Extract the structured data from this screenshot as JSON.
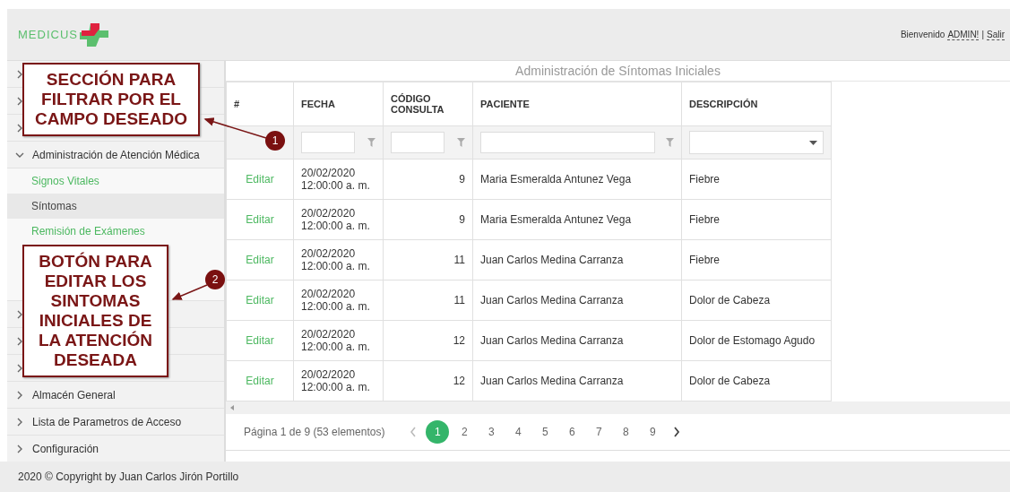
{
  "header": {
    "logo": "MEDICUS",
    "greeting": "Bienvenido",
    "user": "ADMIN!",
    "separator": "|",
    "logout": "Salir"
  },
  "sidebar": {
    "items": [
      {
        "expanded": false
      },
      {
        "expanded": false
      },
      {
        "expanded": false
      },
      {
        "label": "Administración de Atención Médica",
        "expanded": true,
        "children": [
          {
            "label": "Signos Vitales",
            "selected": false
          },
          {
            "label": "Síntomas",
            "selected": true
          },
          {
            "label": "Remisión de Exámenes",
            "selected": false
          }
        ]
      },
      {
        "expanded": false
      },
      {
        "expanded": false
      },
      {
        "expanded": false
      },
      {
        "label": "Almacén General",
        "expanded": false
      },
      {
        "label": "Lista de Parametros de Acceso",
        "expanded": false
      },
      {
        "label": "Configuración",
        "expanded": false
      }
    ]
  },
  "panel": {
    "title": "Administración de Síntomas Iniciales"
  },
  "table": {
    "columns": [
      "#",
      "FECHA",
      "CÓDIGO CONSULTA",
      "PACIENTE",
      "DESCRIPCIÓN"
    ],
    "filters": [
      {
        "kind": "none"
      },
      {
        "kind": "text"
      },
      {
        "kind": "text"
      },
      {
        "kind": "text"
      },
      {
        "kind": "select"
      }
    ],
    "rows": [
      {
        "action": "Editar",
        "date": "20/02/2020",
        "time": "12:00:00 a. m.",
        "code": "9",
        "patient": "Maria Esmeralda Antunez Vega",
        "description": "Fiebre"
      },
      {
        "action": "Editar",
        "date": "20/02/2020",
        "time": "12:00:00 a. m.",
        "code": "9",
        "patient": "Maria Esmeralda Antunez Vega",
        "description": "Fiebre"
      },
      {
        "action": "Editar",
        "date": "20/02/2020",
        "time": "12:00:00 a. m.",
        "code": "11",
        "patient": "Juan Carlos Medina Carranza",
        "description": "Fiebre"
      },
      {
        "action": "Editar",
        "date": "20/02/2020",
        "time": "12:00:00 a. m.",
        "code": "11",
        "patient": "Juan Carlos Medina Carranza",
        "description": "Dolor de Cabeza"
      },
      {
        "action": "Editar",
        "date": "20/02/2020",
        "time": "12:00:00 a. m.",
        "code": "12",
        "patient": "Juan Carlos Medina Carranza",
        "description": "Dolor de Estomago Agudo"
      },
      {
        "action": "Editar",
        "date": "20/02/2020",
        "time": "12:00:00 a. m.",
        "code": "12",
        "patient": "Juan Carlos Medina Carranza",
        "description": "Dolor de Cabeza"
      }
    ]
  },
  "pager": {
    "summary": "Página 1 de 9 (53 elementos)",
    "pages": [
      {
        "label": "1",
        "selected": true
      },
      {
        "label": "2",
        "selected": false
      },
      {
        "label": "3",
        "selected": false
      },
      {
        "label": "4",
        "selected": false
      },
      {
        "label": "5",
        "selected": false
      },
      {
        "label": "6",
        "selected": false
      },
      {
        "label": "7",
        "selected": false
      },
      {
        "label": "8",
        "selected": false
      },
      {
        "label": "9",
        "selected": false
      }
    ]
  },
  "footer": {
    "copyright": "2020 © Copyright by Juan Carlos Jirón Portillo"
  },
  "callouts": [
    {
      "badge": "1",
      "text": "SECCIÓN PARA FILTRAR POR EL CAMPO DESEADO"
    },
    {
      "badge": "2",
      "text": "BOTÓN PARA EDITAR LOS SINTOMAS INICIALES DE LA ATENCIÓN DESEADA"
    }
  ]
}
